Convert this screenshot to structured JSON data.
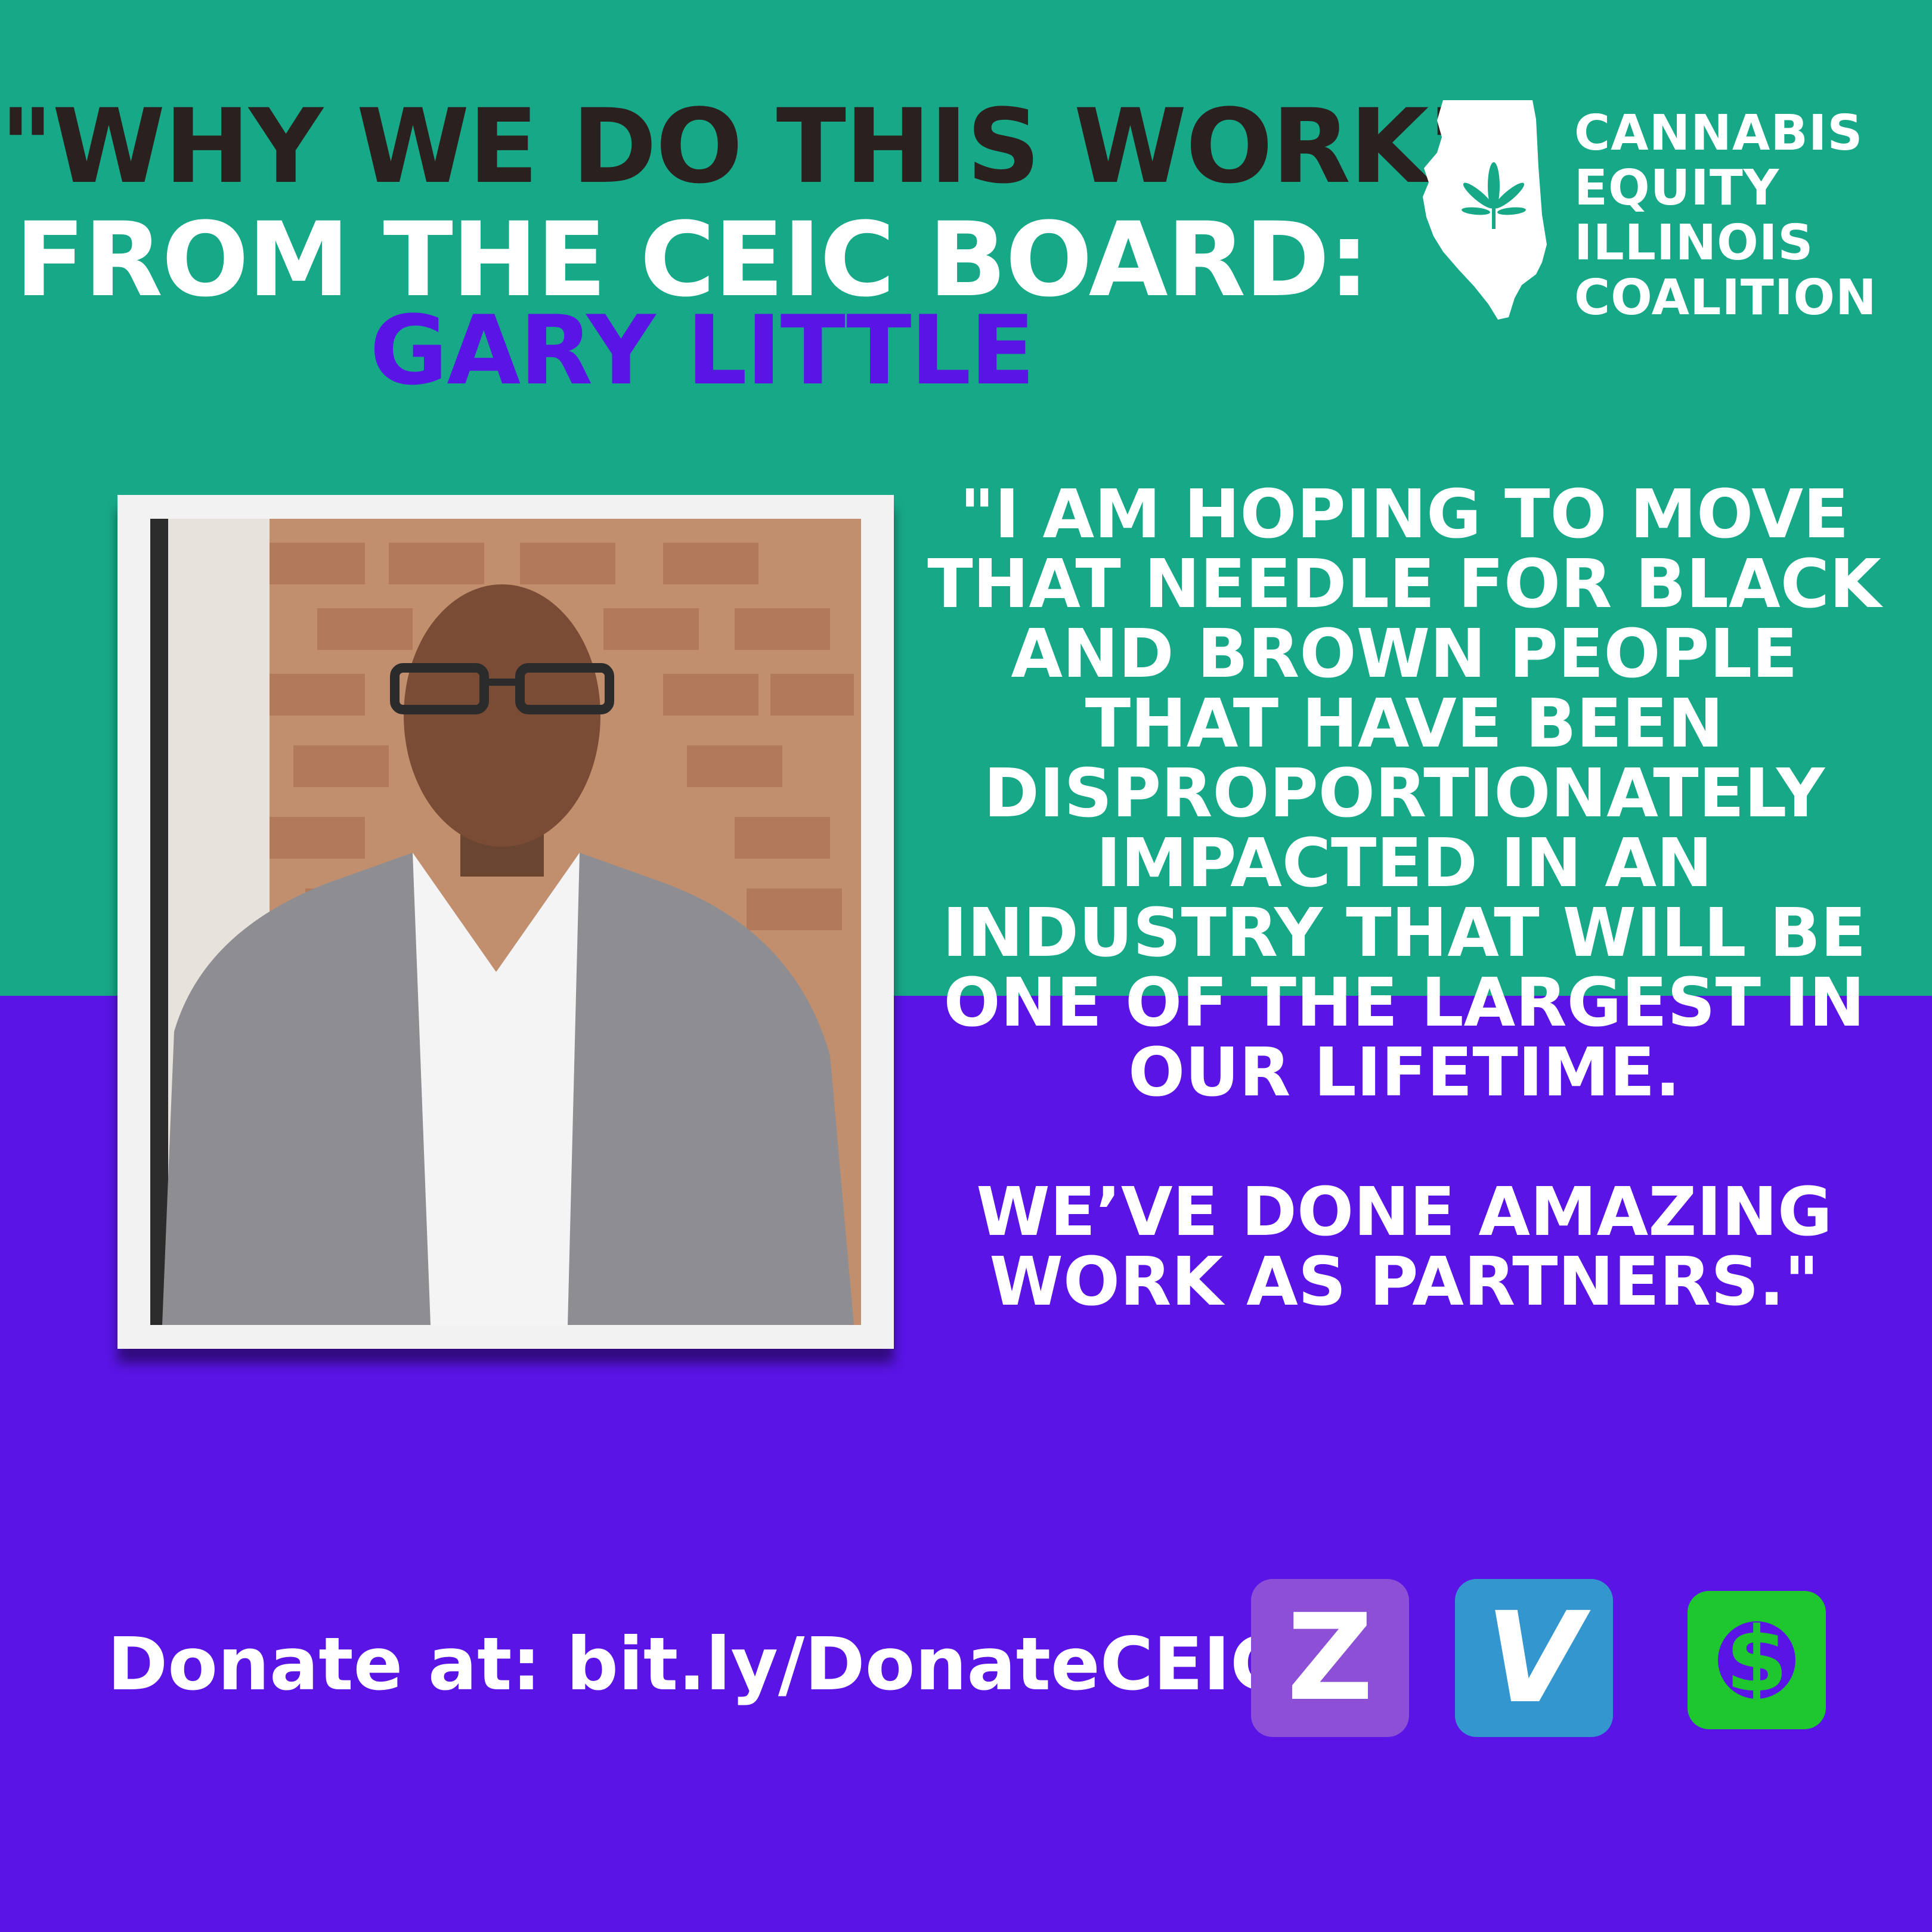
{
  "header": {
    "line1": "\"WHY WE DO THIS WORK\"",
    "line2": "FROM THE CEIC BOARD:",
    "name": "GARY LITTLE"
  },
  "logo": {
    "icon": "illinois-state-cannabis-leaf-icon",
    "lines": [
      "CANNABIS",
      "EQUITY",
      "ILLINOIS",
      "COALITION"
    ]
  },
  "photo": {
    "alt": "Gary Little"
  },
  "quote": {
    "paragraph1": "\"I AM HOPING TO MOVE THAT NEEDLE FOR BLACK AND BROWN PEOPLE THAT HAVE BEEN DISPROPORTIONATELY IMPACTED IN AN INDUSTRY THAT WILL BE ONE OF THE LARGEST IN OUR LIFETIME.",
    "paragraph2": "WE’VE DONE AMAZING WORK AS PARTNERS.\""
  },
  "footer": {
    "donate_text": "Donate at: bit.ly/DonateCEIC",
    "payments": [
      {
        "name": "zelle-icon",
        "glyph": "Z"
      },
      {
        "name": "venmo-icon",
        "glyph": "V"
      },
      {
        "name": "cash-app-icon",
        "glyph": "$"
      }
    ]
  },
  "colors": {
    "teal": "#17a888",
    "purple": "#5a14e6",
    "dark": "#2a201d",
    "white": "#ffffff"
  }
}
